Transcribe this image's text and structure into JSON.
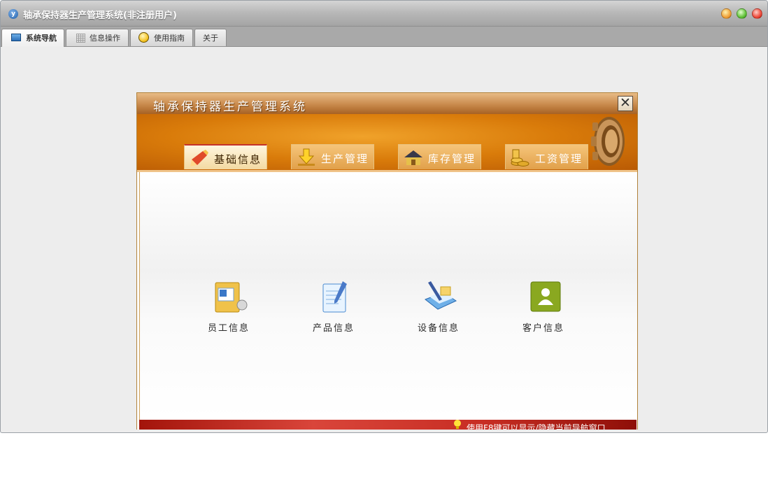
{
  "window": {
    "title": "轴承保持器生产管理系统(非注册用户)"
  },
  "top_tabs": [
    {
      "label": "系统导航",
      "icon": "monitor-icon",
      "active": true
    },
    {
      "label": "信息操作",
      "icon": "grid-icon",
      "active": false
    },
    {
      "label": "使用指南",
      "icon": "guide-icon",
      "active": false
    },
    {
      "label": "关于",
      "icon": "",
      "active": false
    }
  ],
  "dialog": {
    "title": "轴承保持器生产管理系统",
    "close_symbol": "✕",
    "nav_tabs": [
      {
        "label": "基础信息",
        "icon": "pencil-icon",
        "active": true
      },
      {
        "label": "生产管理",
        "icon": "download-arrow-icon",
        "active": false
      },
      {
        "label": "库存管理",
        "icon": "warehouse-icon",
        "active": false
      },
      {
        "label": "工资管理",
        "icon": "coins-icon",
        "active": false
      }
    ],
    "items": [
      {
        "label": "员工信息",
        "icon": "employee-folder-icon"
      },
      {
        "label": "产品信息",
        "icon": "notepad-icon"
      },
      {
        "label": "设备信息",
        "icon": "equipment-pen-icon"
      },
      {
        "label": "客户信息",
        "icon": "customer-icon"
      }
    ],
    "footer_hint": "使用F8键可以显示/隐藏当前导航窗口"
  },
  "colors": {
    "header_orange": "#d97b0a",
    "footer_red": "#c72d23",
    "title_gray": "#b9b9b9"
  }
}
